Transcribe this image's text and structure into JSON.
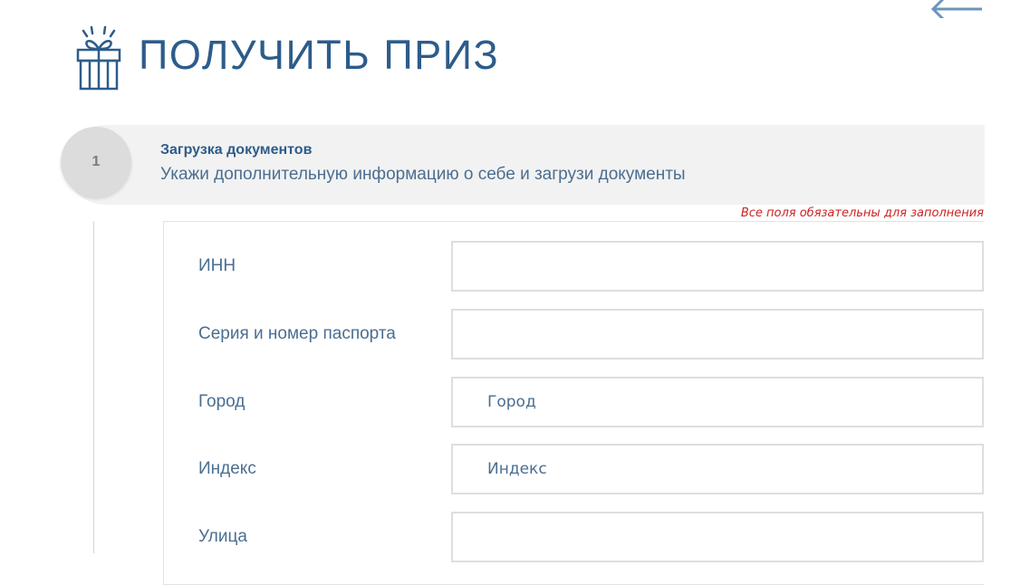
{
  "header": {
    "title": "ПОЛУЧИТЬ ПРИЗ"
  },
  "step": {
    "number": "1",
    "title": "Загрузка документов",
    "subtitle": "Укажи дополнительную информацию о себе и загрузи документы"
  },
  "form": {
    "required_note": "Все поля обязательны для заполнения",
    "fields": [
      {
        "label": "ИНН",
        "value": "",
        "placeholder": ""
      },
      {
        "label": "Серия и номер паспорта",
        "value": "",
        "placeholder": ""
      },
      {
        "label": "Город",
        "value": "",
        "placeholder": "Город"
      },
      {
        "label": "Индекс",
        "value": "",
        "placeholder": "Индекс"
      },
      {
        "label": "Улица",
        "value": "",
        "placeholder": ""
      }
    ]
  },
  "icons": {
    "back": "arrow-left-icon",
    "gift": "gift-icon"
  },
  "colors": {
    "primary": "#2d5c8a",
    "text": "#4b6e91",
    "error": "#cc2222",
    "step_bg": "#f2f2f2"
  }
}
